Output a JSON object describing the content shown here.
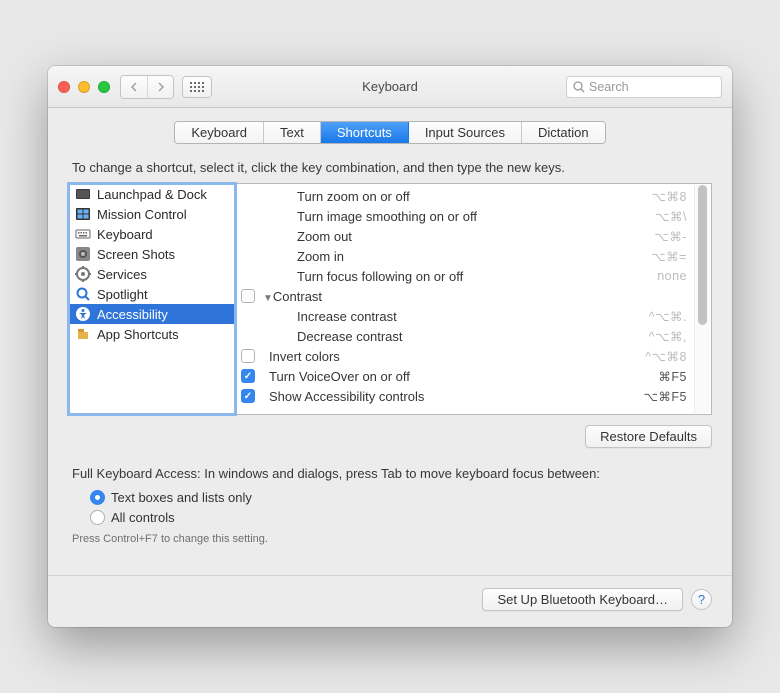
{
  "window": {
    "title": "Keyboard"
  },
  "search": {
    "placeholder": "Search"
  },
  "tabs": [
    {
      "label": "Keyboard",
      "active": false
    },
    {
      "label": "Text",
      "active": false
    },
    {
      "label": "Shortcuts",
      "active": true
    },
    {
      "label": "Input Sources",
      "active": false
    },
    {
      "label": "Dictation",
      "active": false
    }
  ],
  "instruction": "To change a shortcut, select it, click the key combination, and then type the new keys.",
  "categories": [
    {
      "icon": "launchpad",
      "label": "Launchpad & Dock"
    },
    {
      "icon": "mission-control",
      "label": "Mission Control"
    },
    {
      "icon": "keyboard",
      "label": "Keyboard"
    },
    {
      "icon": "screenshots",
      "label": "Screen Shots"
    },
    {
      "icon": "services",
      "label": "Services"
    },
    {
      "icon": "spotlight",
      "label": "Spotlight"
    },
    {
      "icon": "accessibility",
      "label": "Accessibility",
      "selected": true
    },
    {
      "icon": "app-shortcuts",
      "label": "App Shortcuts"
    }
  ],
  "shortcuts": [
    {
      "indent": 2,
      "checkbox": null,
      "label": "Turn zoom on or off",
      "keys": "⌥⌘8",
      "enabled": false
    },
    {
      "indent": 2,
      "checkbox": null,
      "label": "Turn image smoothing on or off",
      "keys": "⌥⌘\\",
      "enabled": false
    },
    {
      "indent": 2,
      "checkbox": null,
      "label": "Zoom out",
      "keys": "⌥⌘-",
      "enabled": false
    },
    {
      "indent": 2,
      "checkbox": null,
      "label": "Zoom in",
      "keys": "⌥⌘=",
      "enabled": false
    },
    {
      "indent": 2,
      "checkbox": null,
      "label": "Turn focus following on or off",
      "keys": "none",
      "enabled": false
    },
    {
      "indent": 1,
      "checkbox": false,
      "disclosure": true,
      "label": "Contrast",
      "keys": "",
      "enabled": false
    },
    {
      "indent": 2,
      "checkbox": null,
      "label": "Increase contrast",
      "keys": "^⌥⌘.",
      "enabled": false
    },
    {
      "indent": 2,
      "checkbox": null,
      "label": "Decrease contrast",
      "keys": "^⌥⌘,",
      "enabled": false
    },
    {
      "indent": 1,
      "checkbox": false,
      "label": "Invert colors",
      "keys": "^⌥⌘8",
      "enabled": false
    },
    {
      "indent": 1,
      "checkbox": true,
      "label": "Turn VoiceOver on or off",
      "keys": "⌘F5",
      "enabled": true
    },
    {
      "indent": 1,
      "checkbox": true,
      "label": "Show Accessibility controls",
      "keys": "⌥⌘F5",
      "enabled": true
    }
  ],
  "restore_label": "Restore Defaults",
  "fka": {
    "text": "Full Keyboard Access: In windows and dialogs, press Tab to move keyboard focus between:",
    "options": [
      {
        "label": "Text boxes and lists only",
        "selected": true
      },
      {
        "label": "All controls",
        "selected": false
      }
    ],
    "hint": "Press Control+F7 to change this setting."
  },
  "bluetooth_label": "Set Up Bluetooth Keyboard…"
}
